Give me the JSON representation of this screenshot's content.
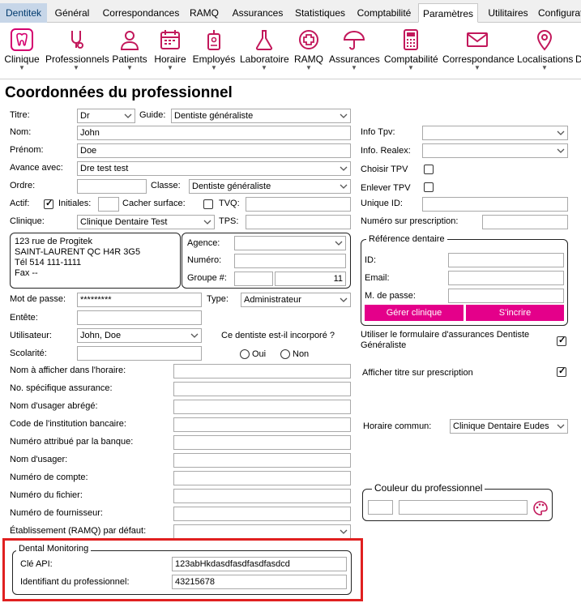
{
  "tabs": [
    "Dentitek",
    "Général",
    "Correspondances",
    "RAMQ",
    "Assurances",
    "Statistiques",
    "Comptabilité",
    "Paramètres",
    "Utilitaires",
    "Configurat"
  ],
  "ribbon": [
    {
      "label": "Clinique",
      "icon": "tooth-icon"
    },
    {
      "label": "Professionnels",
      "icon": "dentist-tools-icon"
    },
    {
      "label": "Patients",
      "icon": "person-icon"
    },
    {
      "label": "Horaire",
      "icon": "calendar-icon"
    },
    {
      "label": "Employés",
      "icon": "badge-icon"
    },
    {
      "label": "Laboratoire",
      "icon": "flask-icon"
    },
    {
      "label": "RAMQ",
      "icon": "medical-cross-icon"
    },
    {
      "label": "Assurances",
      "icon": "umbrella-icon"
    },
    {
      "label": "Comptabilité",
      "icon": "calculator-icon"
    },
    {
      "label": "Correspondance",
      "icon": "envelope-icon"
    },
    {
      "label": "Localisations",
      "icon": "map-pin-icon"
    },
    {
      "label": "D",
      "icon": ""
    }
  ],
  "page_title": "Coordonnées du professionnel",
  "form": {
    "titre_label": "Titre:",
    "titre_value": "Dr",
    "guide_label": "Guide:",
    "guide_value": "Dentiste généraliste",
    "nom_label": "Nom:",
    "nom_value": "John",
    "prenom_label": "Prénom:",
    "prenom_value": "Doe",
    "avance_label": "Avance avec:",
    "avance_value": "Dre test test",
    "ordre_label": "Ordre:",
    "classe_label": "Classe:",
    "classe_value": "Dentiste généraliste",
    "actif_label": "Actif:",
    "initiales_label": "Initiales:",
    "cacher_label": "Cacher surface:",
    "tvq_label": "TVQ:",
    "clinique_label": "Clinique:",
    "clinique_value": "Clinique Dentaire Test",
    "tps_label": "TPS:",
    "address_lines": [
      "123 rue de Progitek",
      "SAINT-LAURENT QC H4R 3G5",
      "Tél 514 111-1111",
      "Fax  --"
    ],
    "agence_label": "Agence:",
    "numero_label": "Numéro:",
    "groupe_label": "Groupe #:",
    "groupe_value": "11",
    "motdepasse_label": "Mot de passe:",
    "motdepasse_value": "*********",
    "type_label": "Type:",
    "type_value": "Administrateur",
    "entete_label": "Entête:",
    "utilisateur_label": "Utilisateur:",
    "utilisateur_value": "John, Doe",
    "incorpore_question": "Ce dentiste est-il incorporé ?",
    "oui_label": "Oui",
    "non_label": "Non",
    "scolarite_label": "Scolarité:",
    "long_fields": [
      "Nom à afficher dans l'horaire:",
      "No. spécifique assurance:",
      "Nom d'usager abrégé:",
      "Code de l'institution bancaire:",
      "Numéro attribué par la banque:",
      "Nom d'usager:",
      "Numéro de compte:",
      "Numéro du fichier:",
      "Numéro de fournisseur:",
      "Établissement (RAMQ) par défaut:"
    ]
  },
  "right": {
    "info_tpv_label": "Info Tpv:",
    "info_realex_label": "Info. Realex:",
    "choisir_tpv_label": "Choisir TPV",
    "enlever_tpv_label": "Enlever TPV",
    "unique_id_label": "Unique ID:",
    "numero_prescription_label": "Numéro sur prescription:",
    "ref_title": "Référence dentaire",
    "id_label": "ID:",
    "email_label": "Email:",
    "mdp_label": "M. de passe:",
    "gerer_button": "Gérer clinique",
    "inscrire_button": "S'incrire",
    "utiliser_label_1": "Utiliser le formulaire d'assurances Dentiste",
    "utiliser_label_2": "Généraliste",
    "afficher_titre_label": "Afficher titre sur prescription",
    "horaire_label": "Horaire commun:",
    "horaire_value": "Clinique Dentaire Eudes",
    "couleur_title": "Couleur du professionnel"
  },
  "dental_monitoring": {
    "title": "Dental Monitoring",
    "cle_label": "Clé API:",
    "cle_value": "123abHkdasdfasdfasdfasdcd",
    "ident_label": "Identifiant du professionnel:",
    "ident_value": "43215678"
  },
  "colors": {
    "accent_pink": "#e4008a",
    "highlight_red": "#e02020",
    "first_tab": "#c7d6e8"
  }
}
